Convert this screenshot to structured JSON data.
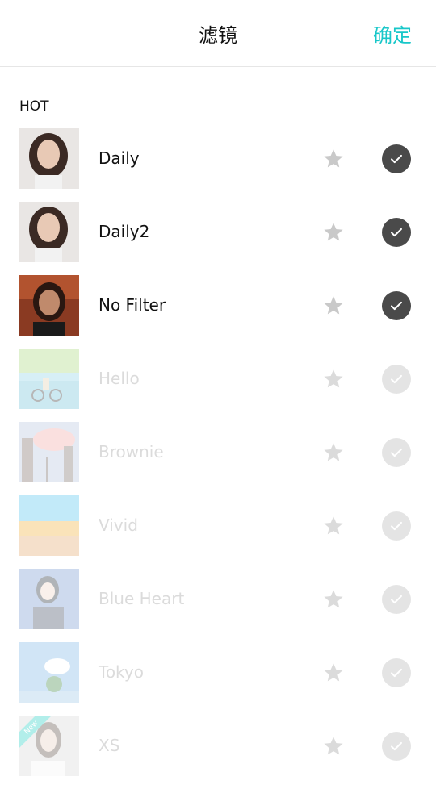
{
  "header": {
    "title": "滤镜",
    "confirm_label": "确定"
  },
  "section": {
    "label": "HOT"
  },
  "filters": [
    {
      "name": "Daily",
      "enabled": true,
      "thumb": "portrait-curly"
    },
    {
      "name": "Daily2",
      "enabled": true,
      "thumb": "portrait-curly"
    },
    {
      "name": "No Filter",
      "enabled": true,
      "thumb": "portrait-dark"
    },
    {
      "name": "Hello",
      "enabled": false,
      "thumb": "bike-sea"
    },
    {
      "name": "Brownie",
      "enabled": false,
      "thumb": "city-sunset"
    },
    {
      "name": "Vivid",
      "enabled": false,
      "thumb": "yellow-building"
    },
    {
      "name": "Blue Heart",
      "enabled": false,
      "thumb": "girl-blue"
    },
    {
      "name": "Tokyo",
      "enabled": false,
      "thumb": "sky-clouds"
    },
    {
      "name": "XS",
      "enabled": false,
      "thumb": "girl-white",
      "badge": "New"
    }
  ],
  "icons": {
    "star": "star-icon",
    "check": "check-icon"
  },
  "colors": {
    "accent": "#18c7c9",
    "check_active": "#4a4a4a",
    "badge": "#26d0c6"
  }
}
